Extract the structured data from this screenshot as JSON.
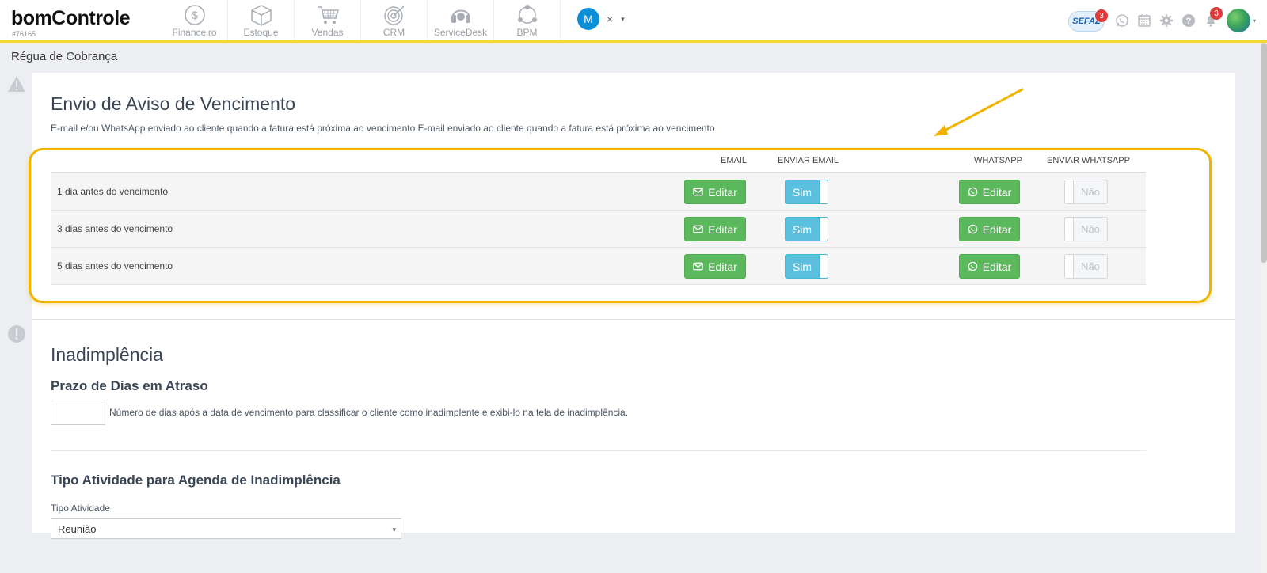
{
  "header": {
    "brand": "bomControle",
    "account_id": "#76165",
    "modules": [
      {
        "label": "Financeiro",
        "icon": "dollar-coin-icon"
      },
      {
        "label": "Estoque",
        "icon": "box-icon"
      },
      {
        "label": "Vendas",
        "icon": "cart-icon"
      },
      {
        "label": "CRM",
        "icon": "target-icon"
      },
      {
        "label": "ServiceDesk",
        "icon": "headset-icon"
      },
      {
        "label": "BPM",
        "icon": "process-icon"
      }
    ],
    "user_initial": "M",
    "chip_close": "×",
    "chip_caret": "▾",
    "sefaz_label": "SEFAZ",
    "sefaz_badge": "3",
    "notifications_badge": "3",
    "avatar_caret": "▾"
  },
  "page": {
    "title": "Régua de Cobrança"
  },
  "aviso": {
    "title": "Envio de Aviso de Vencimento",
    "description": "E-mail e/ou WhatsApp enviado ao cliente quando a fatura está próxima ao vencimento E-mail enviado ao cliente quando a fatura está próxima ao vencimento",
    "columns": {
      "email": "EMAIL",
      "send_email": "ENVIAR EMAIL",
      "whatsapp": "WHATSAPP",
      "send_whatsapp": "ENVIAR WHATSAPP"
    },
    "rows": [
      {
        "label": "1 dia antes do vencimento",
        "email_button": "Editar",
        "send_email": "Sim",
        "whatsapp_button": "Editar",
        "send_whatsapp": "Não"
      },
      {
        "label": "3 dias antes do vencimento",
        "email_button": "Editar",
        "send_email": "Sim",
        "whatsapp_button": "Editar",
        "send_whatsapp": "Não"
      },
      {
        "label": "5 dias antes do vencimento",
        "email_button": "Editar",
        "send_email": "Sim",
        "whatsapp_button": "Editar",
        "send_whatsapp": "Não"
      }
    ]
  },
  "inadimplencia": {
    "title": "Inadimplência",
    "prazo_title": "Prazo de Dias em Atraso",
    "prazo_value": "",
    "prazo_help": "Número de dias após a data de vencimento para classificar o cliente como inadimplente e exibi-lo na tela de inadimplência.",
    "tipo_title": "Tipo Atividade para Agenda de Inadimplência",
    "tipo_label": "Tipo Atividade",
    "tipo_selected": "Reunião",
    "tipo_caret": "▾"
  },
  "colors": {
    "accent_yellow": "#f5d933",
    "highlight_orange": "#f0b400",
    "success_green": "#5cb85c",
    "info_blue": "#5bc0de",
    "badge_red": "#e0393a",
    "user_blue": "#0b8fd8"
  }
}
